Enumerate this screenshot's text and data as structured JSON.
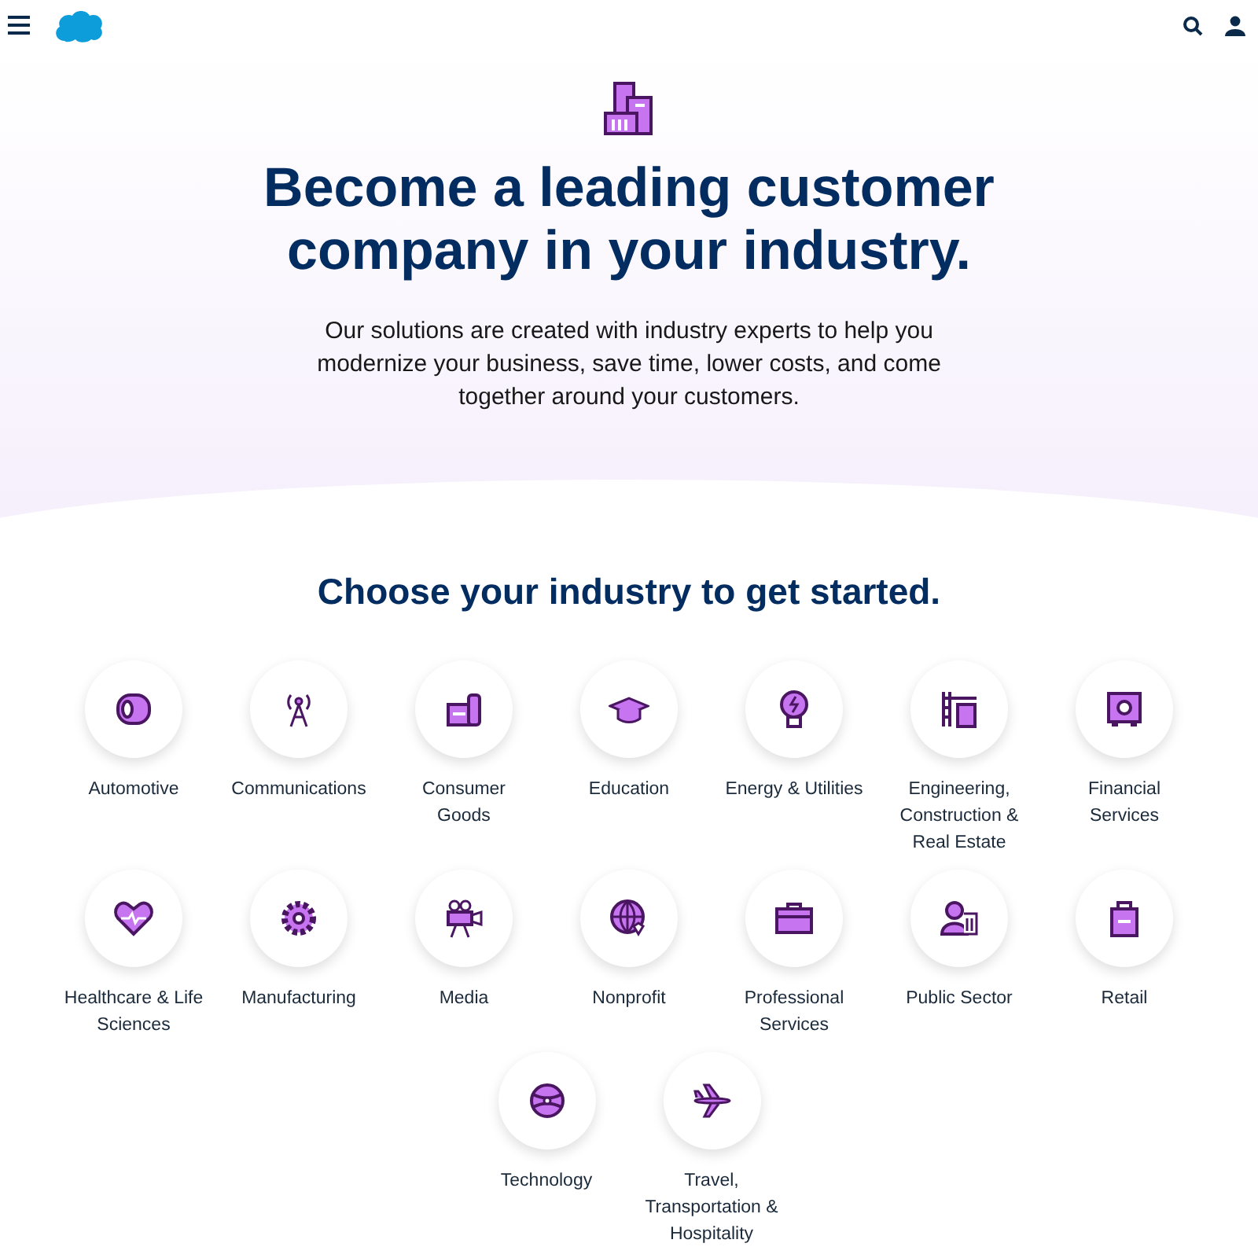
{
  "hero": {
    "title": "Become a leading customer company in your industry.",
    "subtitle": "Our solutions are created with industry experts to help you modernize your business, save time, lower costs, and come together around your customers."
  },
  "section_title": "Choose your industry to get started.",
  "industries": [
    {
      "label": "Automotive"
    },
    {
      "label": "Communications"
    },
    {
      "label": "Consumer Goods"
    },
    {
      "label": "Education"
    },
    {
      "label": "Energy & Utilities"
    },
    {
      "label": "Engineering, Construction & Real Estate"
    },
    {
      "label": "Financial Services"
    },
    {
      "label": "Healthcare & Life Sciences"
    },
    {
      "label": "Manufacturing"
    },
    {
      "label": "Media"
    },
    {
      "label": "Nonprofit"
    },
    {
      "label": "Professional Services"
    },
    {
      "label": "Public Sector"
    },
    {
      "label": "Retail"
    },
    {
      "label": "Technology"
    },
    {
      "label": "Travel, Transportation & Hospitality"
    }
  ]
}
